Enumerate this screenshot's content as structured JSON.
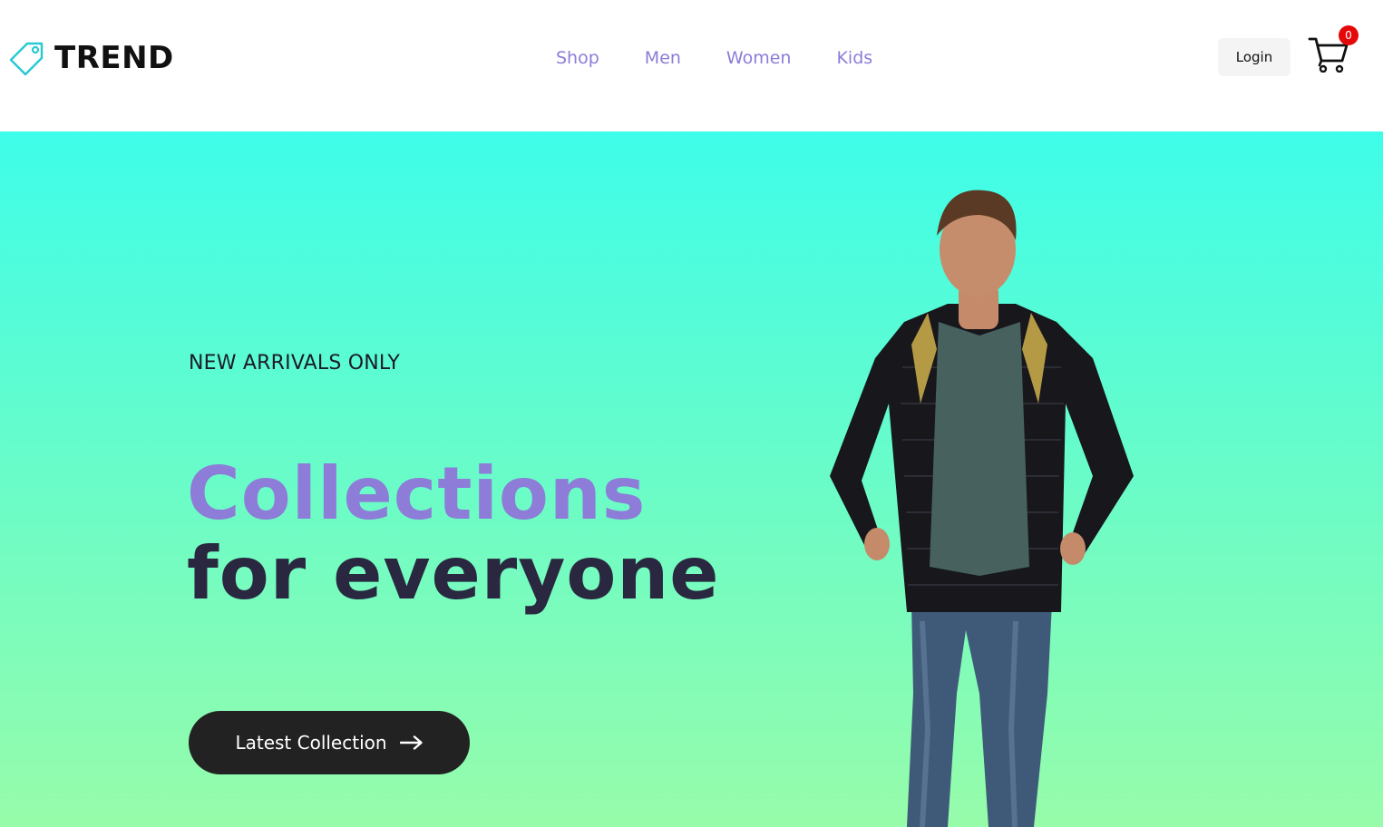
{
  "header": {
    "logo_text": "TREND",
    "nav": [
      {
        "label": "Shop"
      },
      {
        "label": "Men"
      },
      {
        "label": "Women"
      },
      {
        "label": "Kids"
      }
    ],
    "login_label": "Login",
    "cart_count": "0"
  },
  "hero": {
    "subtitle": "NEW ARRIVALS ONLY",
    "title_line1": "Collections",
    "title_line2": "for everyone",
    "cta_label": "Latest Collection"
  },
  "colors": {
    "accent": "#8d7cd8",
    "hero_gradient_top": "#3efde9",
    "hero_gradient_bottom": "#97fcaa",
    "cta_bg": "#222222",
    "badge": "#e5080a"
  },
  "icons": {
    "logo": "price-tag-icon",
    "cart": "shopping-cart-icon",
    "cta": "arrow-right-icon"
  }
}
